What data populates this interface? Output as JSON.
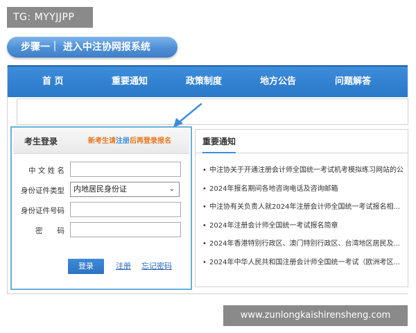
{
  "watermark": {
    "tag": "TG: MYYJJPP",
    "url": "www.zunlongkaishirensheng.com"
  },
  "step": {
    "label": "步骤一｜ 进入中注协网报系统"
  },
  "nav": {
    "items": [
      "首 页",
      "重要通知",
      "政策制度",
      "地方公告",
      "问题解答"
    ]
  },
  "login": {
    "title": "考生登录",
    "note_prefix": "新考生请",
    "note_link": "注册",
    "note_suffix": "后再登录报名",
    "name_label": "中 文 姓 名",
    "id_type_label": "身份证件类型",
    "id_type_value": "内地居民身份证",
    "id_number_label": "身份证件号码",
    "password_label": "密　　码",
    "login_button": "登录",
    "register_link": "注册",
    "forgot_link": "忘记密码"
  },
  "notice": {
    "title": "重要通知",
    "items": [
      "中注协关于开通注册会计师全国统一考试机考模拟练习网站的公",
      "2024年报名期间各地咨询电话及咨询邮箱",
      "中注协有关负责人就2024年注册会计师全国统一考试报名相...",
      "2024年注册会计师全国统一考试报名简章",
      "2024年香港特别行政区、澳门特别行政区、台湾地区居民及...",
      "2024年中华人民共和国注册会计师全国统一考试（欧洲考区..."
    ]
  },
  "colors": {
    "nav": "#2a78c8",
    "accent_orange": "#e8781f",
    "login_border": "#6ab0d8",
    "button": "#2c73c2"
  }
}
